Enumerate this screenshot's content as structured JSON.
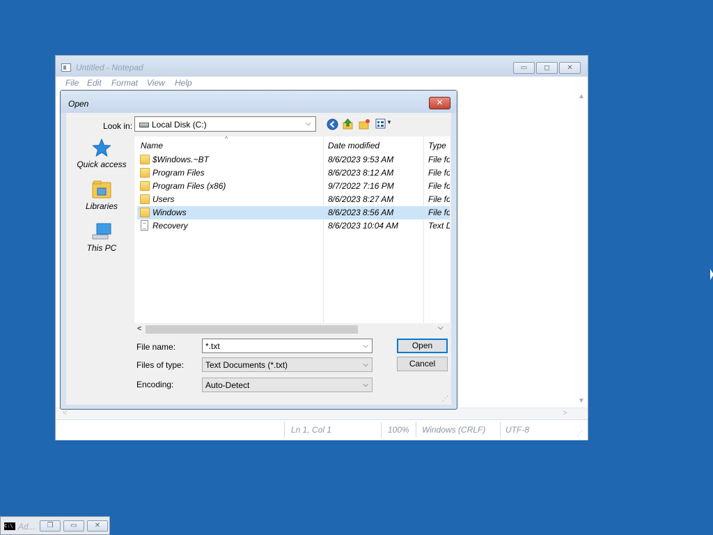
{
  "notepad": {
    "title": "Untitled - Notepad",
    "menu": [
      "File",
      "Edit",
      "Format",
      "View",
      "Help"
    ],
    "status": {
      "position": "Ln 1, Col 1",
      "zoom": "100%",
      "line_ending": "Windows (CRLF)",
      "encoding": "UTF-8"
    }
  },
  "dialog": {
    "title": "Open",
    "close_glyph": "✕",
    "look_in_label": "Look in:",
    "look_in_value": "Local Disk (C:)",
    "places": [
      {
        "label": "Quick access",
        "icon": "star-icon"
      },
      {
        "label": "Libraries",
        "icon": "libraries-icon"
      },
      {
        "label": "This PC",
        "icon": "computer-icon"
      }
    ],
    "columns": [
      "Name",
      "Date modified",
      "Type"
    ],
    "files": [
      {
        "name": "$Windows.~BT",
        "date": "8/6/2023 9:53 AM",
        "type": "File folder",
        "kind": "folder"
      },
      {
        "name": "Program Files",
        "date": "8/6/2023 8:12 AM",
        "type": "File folder",
        "kind": "folder"
      },
      {
        "name": "Program Files (x86)",
        "date": "9/7/2022 7:16 PM",
        "type": "File folder",
        "kind": "folder"
      },
      {
        "name": "Users",
        "date": "8/6/2023 8:27 AM",
        "type": "File folder",
        "kind": "folder"
      },
      {
        "name": "Windows",
        "date": "8/6/2023 8:56 AM",
        "type": "File folder",
        "kind": "folder",
        "selected": true
      },
      {
        "name": "Recovery",
        "date": "8/6/2023 10:04 AM",
        "type": "Text Document",
        "kind": "file"
      }
    ],
    "file_name_label": "File name:",
    "file_name_value": "*.txt",
    "file_type_label": "Files of type:",
    "file_type_value": "Text Documents (*.txt)",
    "encoding_label": "Encoding:",
    "encoding_value": "Auto-Detect",
    "open_label": "Open",
    "cancel_label": "Cancel"
  },
  "taskbar": {
    "minimized_title": "Ad...",
    "cmd_icon_text": "C:\\"
  },
  "colors": {
    "desktop": "#1f67b1",
    "selection": "#cce4f7",
    "default_button_border": "#0078d7",
    "close_button": "#c7463a"
  }
}
